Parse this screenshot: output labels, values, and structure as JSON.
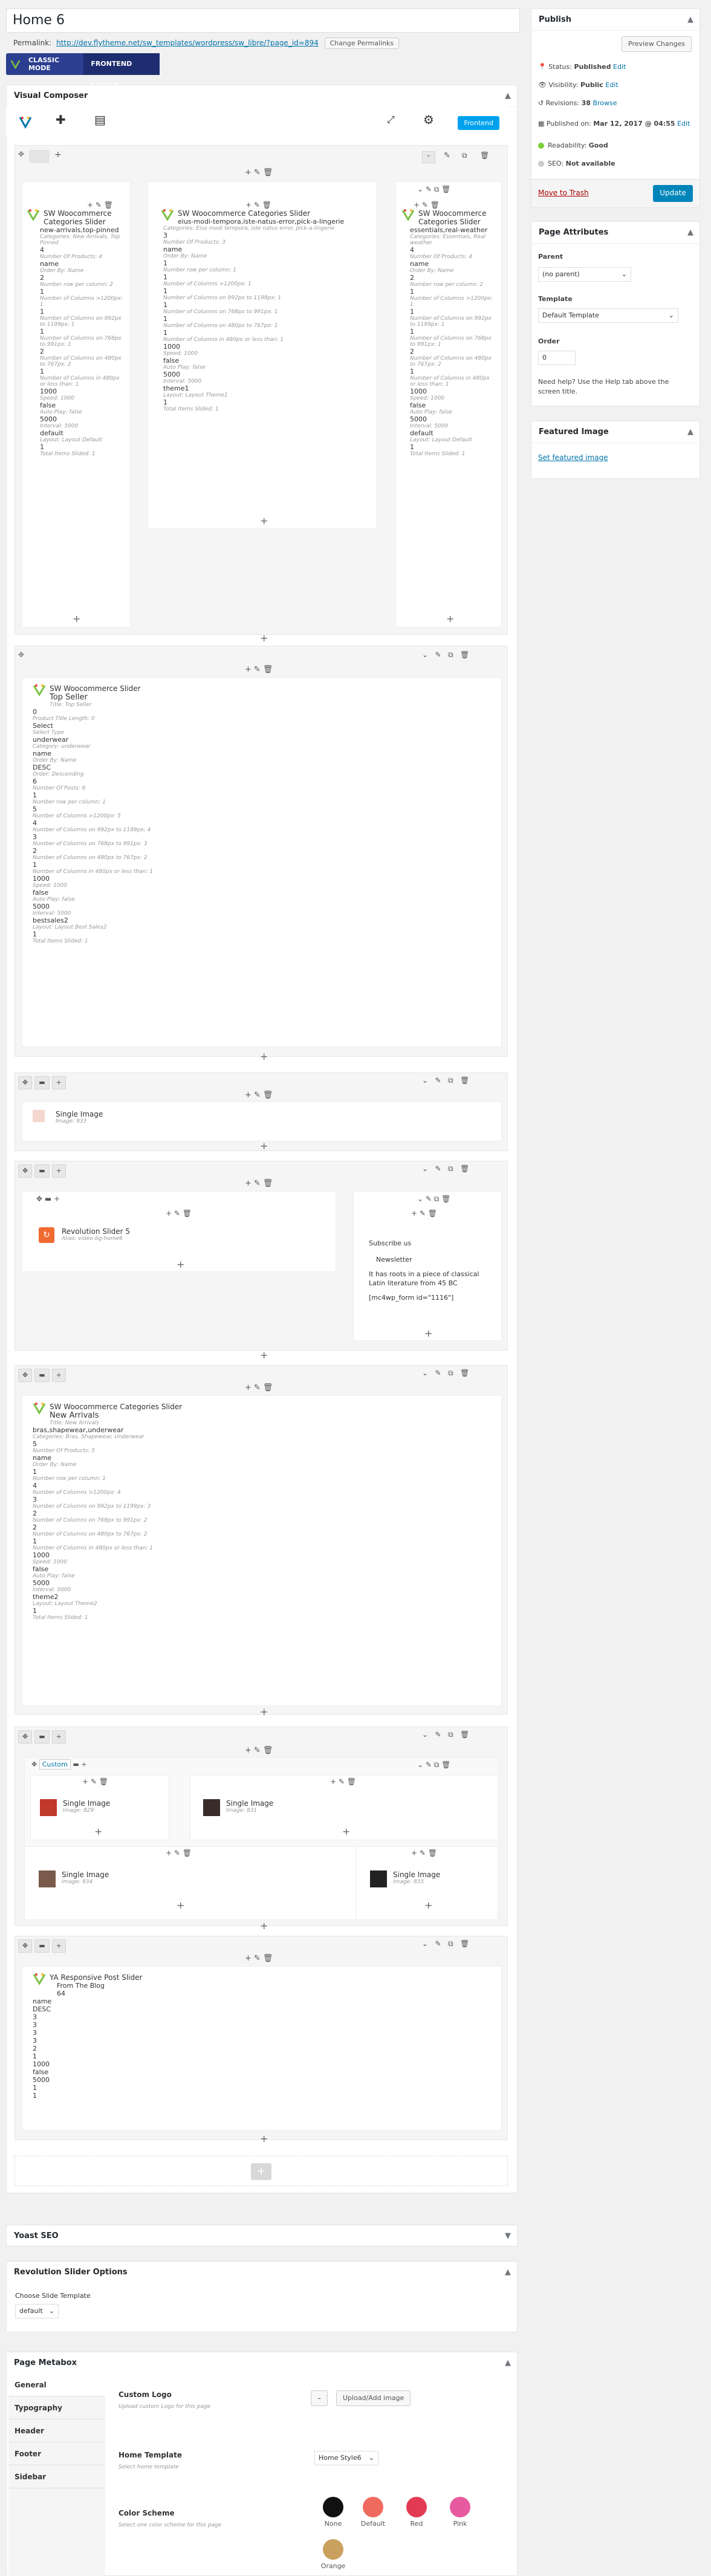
{
  "title": "Home 6",
  "permalink": {
    "label": "Permalink:",
    "url": "http://dev.flytheme.net/sw_templates/wordpress/sw_libre/?page_id=894",
    "change_btn": "Change Permalinks"
  },
  "editor_switch": {
    "classic": "CLASSIC MODE",
    "frontend": "FRONTEND EDITOR"
  },
  "visual_composer": {
    "title": "Visual Composer",
    "frontend_btn": "Frontend"
  },
  "rows": {
    "r1": {
      "c1": {
        "name": "SW Woocommerce Categories Slider",
        "sub": "new-arrivals,top-pinned",
        "sub_lbl": "Categories: New Arrivals, Top Pinned",
        "f": [
          [
            "4",
            "Number Of Products: 4"
          ],
          [
            "name",
            "Order By: Name"
          ],
          [
            "2",
            "Number row per column: 2"
          ],
          [
            "1",
            "Number of Columns >1200px: 1"
          ],
          [
            "1",
            "Number of Columns on 992px to 1199px: 1"
          ],
          [
            "1",
            "Number of Columns on 768px to 991px: 1"
          ],
          [
            "2",
            "Number of Columns on 480px to 767px: 2"
          ],
          [
            "1",
            "Number of Columns in 480px or less than: 1"
          ],
          [
            "1000",
            "Speed: 1000"
          ],
          [
            "false",
            "Auto Play: false"
          ],
          [
            "5000",
            "Interval: 5000"
          ],
          [
            "default",
            "Layout: Layout Default"
          ],
          [
            "1",
            "Total Items Slided: 1"
          ]
        ]
      },
      "c2": {
        "name": "SW Woocommerce Categories Slider",
        "sub": "eius-modi-tempora,iste-natus-error,pick-a-lingerie",
        "sub_lbl": "Categories: Eius modi tempora, iste natus error, pick-a-lingerie",
        "f": [
          [
            "3",
            "Number Of Products: 3"
          ],
          [
            "name",
            "Order By: Name"
          ],
          [
            "1",
            "Number row per column: 1"
          ],
          [
            "1",
            "Number of Columns >1200px: 1"
          ],
          [
            "1",
            "Number of Columns on 992px to 1199px: 1"
          ],
          [
            "1",
            "Number of Columns on 768px to 991px: 1"
          ],
          [
            "1",
            "Number of Columns on 480px to 767px: 1"
          ],
          [
            "1",
            "Number of Columns in 480px or less than: 1"
          ],
          [
            "1000",
            "Speed: 1000"
          ],
          [
            "false",
            "Auto Play: false"
          ],
          [
            "5000",
            "Interval: 5000"
          ],
          [
            "theme1",
            "Layout: Layout Theme1"
          ],
          [
            "1",
            "Total Items Slided: 1"
          ]
        ]
      },
      "c3": {
        "name": "SW Woocommerce Categories Slider",
        "sub": "essentials,real-weather",
        "sub_lbl": "Categories: Essentials, Real weather",
        "f": [
          [
            "4",
            "Number Of Products: 4"
          ],
          [
            "name",
            "Order By: Name"
          ],
          [
            "2",
            "Number row per column: 2"
          ],
          [
            "1",
            "Number of Columns >1200px: 1"
          ],
          [
            "1",
            "Number of Columns on 992px to 1199px: 1"
          ],
          [
            "1",
            "Number of Columns on 768px to 991px: 1"
          ],
          [
            "2",
            "Number of Columns on 480px to 767px: 2"
          ],
          [
            "1",
            "Number of Columns in 480px or less than: 1"
          ],
          [
            "1000",
            "Speed: 1000"
          ],
          [
            "false",
            "Auto Play: false"
          ],
          [
            "5000",
            "Interval: 5000"
          ],
          [
            "default",
            "Layout: Layout Default"
          ],
          [
            "1",
            "Total Items Slided: 1"
          ]
        ]
      }
    },
    "r2": {
      "name": "SW Woocommerce Slider",
      "sub": "Top Seller",
      "sub_lbl": "Title: Top Seller",
      "f": [
        [
          "0",
          "Product Title Length: 0"
        ],
        [
          "Select",
          "Select Type"
        ],
        [
          "underwear",
          "Category: underwear"
        ],
        [
          "name",
          "Order By: Name"
        ],
        [
          "DESC",
          "Order: Descending"
        ],
        [
          "6",
          "Number Of Posts: 6"
        ],
        [
          "1",
          "Number row per column: 1"
        ],
        [
          "5",
          "Number of Columns >1200px: 5"
        ],
        [
          "4",
          "Number of Columns on 992px to 1199px: 4"
        ],
        [
          "3",
          "Number of Columns on 768px to 991px: 3"
        ],
        [
          "2",
          "Number of Columns on 480px to 767px: 2"
        ],
        [
          "1",
          "Number of Columns in 480px or less than: 1"
        ],
        [
          "1000",
          "Speed: 1000"
        ],
        [
          "false",
          "Auto Play: false"
        ],
        [
          "5000",
          "Interval: 5000"
        ],
        [
          "bestsales2",
          "Layout: Layout Best Sales2"
        ],
        [
          "1",
          "Total Items Slided: 1"
        ]
      ]
    },
    "r3": {
      "name": "Single Image",
      "sub": "Image: 933"
    },
    "r4": {
      "rev_name": "Revolution Slider 5",
      "rev_sub": "Alias: video-bg-home6",
      "subscribe": "Subscribe us",
      "newsletter": "Newsletter",
      "desc": "It has roots in a piece of classical Latin literature from 45 BC",
      "shortcode": "[mc4wp_form id=\"1116\"]"
    },
    "r5": {
      "name": "SW Woocommerce Categories Slider",
      "sub": "New Arrivals",
      "sub_lbl": "Title: New Arrivals",
      "cats": "bras,shapewear,underwear",
      "cats_lbl": "Categories: Bras, Shapewear, Underwear",
      "f": [
        [
          "5",
          "Number Of Products: 5"
        ],
        [
          "name",
          "Order By: Name"
        ],
        [
          "1",
          "Number row per column: 1"
        ],
        [
          "4",
          "Number of Columns >1200px: 4"
        ],
        [
          "3",
          "Number of Columns on 992px to 1199px: 3"
        ],
        [
          "2",
          "Number of Columns on 768px to 991px: 2"
        ],
        [
          "2",
          "Number of Columns on 480px to 767px: 2"
        ],
        [
          "1",
          "Number of Columns in 480px or less than: 1"
        ],
        [
          "1000",
          "Speed: 1000"
        ],
        [
          "false",
          "Auto Play: false"
        ],
        [
          "5000",
          "Interval: 5000"
        ],
        [
          "theme2",
          "Layout: Layout Theme2"
        ],
        [
          "1",
          "Total Items Slided: 1"
        ]
      ]
    },
    "r6": {
      "custom_label": "Custom",
      "imgs": [
        {
          "name": "Single Image",
          "sub": "Image: 829"
        },
        {
          "name": "Single Image",
          "sub": "Image: 831"
        },
        {
          "name": "Single Image",
          "sub": "Image: 834"
        },
        {
          "name": "Single Image",
          "sub": "Image: 835"
        }
      ]
    },
    "r7": {
      "name": "YA Responsive Post Slider",
      "sub": "From The Blog",
      "f": [
        "64",
        "name",
        "DESC",
        "3",
        "3",
        "3",
        "3",
        "2",
        "1",
        "1000",
        "false",
        "5000",
        "1",
        "1"
      ]
    }
  },
  "yoast": "Yoast SEO",
  "rev_options": {
    "title": "Revolution Slider Options",
    "label": "Choose Slide Template",
    "value": "default"
  },
  "metabox": {
    "title": "Page Metabox",
    "tabs": [
      "General",
      "Typography",
      "Header",
      "Footer",
      "Sidebar"
    ],
    "logo": {
      "label": "Custom Logo",
      "desc": "Upload custom Logo for this page",
      "btn": "Upload/Add image"
    },
    "template": {
      "label": "Home Template",
      "desc": "Select home template",
      "value": "Home Style6"
    },
    "color": {
      "label": "Color Scheme",
      "desc": "Select one color scheme for this page",
      "options": [
        {
          "name": "None",
          "color": "#111111"
        },
        {
          "name": "Default",
          "color": "#ef6a5e"
        },
        {
          "name": "Red",
          "color": "#e33a54"
        },
        {
          "name": "Pink",
          "color": "#e85aa0"
        },
        {
          "name": "Orange",
          "color": "#caa05e"
        }
      ]
    }
  },
  "publish": {
    "title": "Publish",
    "preview": "Preview Changes",
    "status_lbl": "Status:",
    "status": "Published",
    "edit": "Edit",
    "vis_lbl": "Visibility:",
    "vis": "Public",
    "rev_lbl": "Revisions:",
    "rev": "38",
    "browse": "Browse",
    "pub_lbl": "Published on:",
    "pub": "Mar 12, 2017 @ 04:55",
    "read_lbl": "Readability:",
    "read": "Good",
    "seo_lbl": "SEO:",
    "seo": "Not available",
    "trash": "Move to Trash",
    "update": "Update"
  },
  "attributes": {
    "title": "Page Attributes",
    "parent_lbl": "Parent",
    "parent": "(no parent)",
    "template_lbl": "Template",
    "template": "Default Template",
    "order_lbl": "Order",
    "order": "0",
    "help": "Need help? Use the Help tab above the screen title."
  },
  "featured": {
    "title": "Featured Image",
    "link": "Set featured image"
  }
}
